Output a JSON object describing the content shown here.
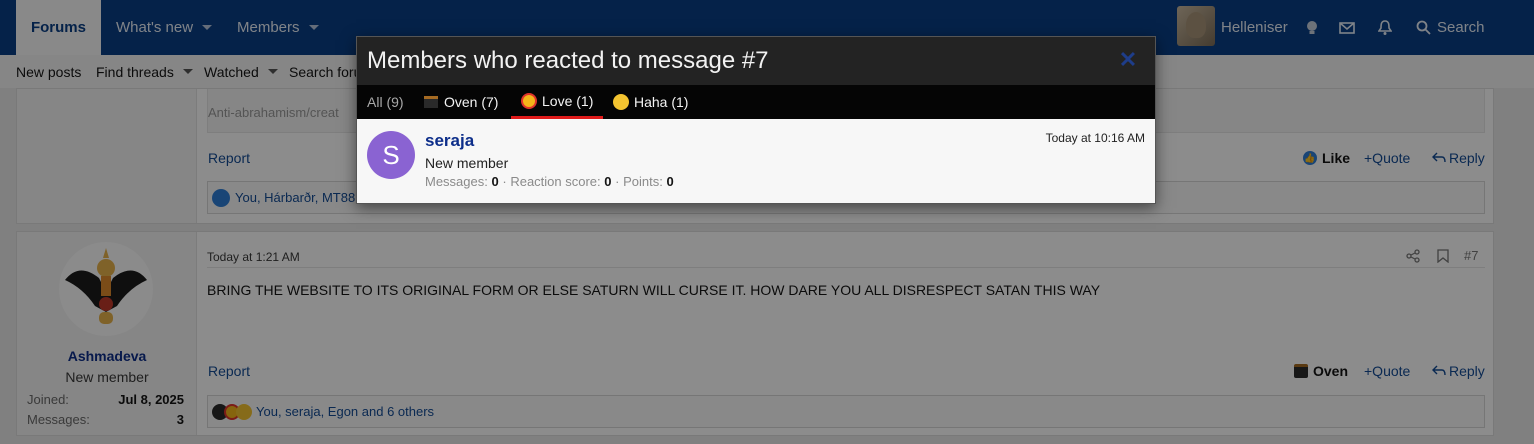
{
  "nav": {
    "tabs": [
      {
        "label": "Forums"
      },
      {
        "label": "What's new"
      },
      {
        "label": "Members"
      }
    ],
    "username": "Helleniser",
    "search_label": "Search"
  },
  "subnav": {
    "items": [
      {
        "label": "New posts"
      },
      {
        "label": "Find threads"
      },
      {
        "label": "Watched"
      },
      {
        "label": "Search foru"
      }
    ]
  },
  "post6": {
    "quote_snippet": "Anti-abrahamism/creat",
    "report": "Report",
    "like": "Like",
    "quote": "+Quote",
    "reply": "Reply",
    "reactions_summary": "You, Hárbarðr, MT88"
  },
  "post7": {
    "timestamp": "Today at 1:21 AM",
    "number": "#7",
    "body": "BRING THE WEBSITE TO ITS ORIGINAL FORM OR ELSE SATURN WILL CURSE IT. HOW DARE YOU ALL DISRESPECT SATAN THIS WAY",
    "report": "Report",
    "reaction": "Oven",
    "quote": "+Quote",
    "reply": "Reply",
    "reactions_summary": "You, seraja, Egon and 6 others",
    "author": {
      "name": "Ashmadeva",
      "title": "New member",
      "joined_label": "Joined:",
      "joined_value": "Jul 8, 2025",
      "messages_label": "Messages:",
      "messages_value": "3"
    }
  },
  "modal": {
    "title": "Members who reacted to message #7",
    "close_glyph": "✕",
    "tabs": [
      {
        "label": "All (9)"
      },
      {
        "label": "Oven (7)"
      },
      {
        "label": "Love (1)"
      },
      {
        "label": "Haha (1)"
      }
    ],
    "member": {
      "avatar_letter": "S",
      "name": "seraja",
      "title": "New member",
      "messages_label": "Messages:",
      "messages_value": "0",
      "sep1": "·",
      "reaction_label": "Reaction score:",
      "reaction_value": "0",
      "sep2": "·",
      "points_label": "Points:",
      "points_value": "0",
      "time": "Today at 10:16 AM"
    }
  },
  "colors": {
    "nav_bg": "#0a3f86",
    "link": "#134b95",
    "love_tab_underline": "#e01b1b",
    "avatar_bg": "#8a63d2"
  },
  "icons": [
    "lightbulb-icon",
    "envelope-icon",
    "bell-icon",
    "search-icon",
    "share-icon",
    "bookmark-icon",
    "like-icon",
    "reply-icon",
    "oven-icon",
    "love-emoji-icon",
    "haha-emoji-icon",
    "close-icon"
  ]
}
